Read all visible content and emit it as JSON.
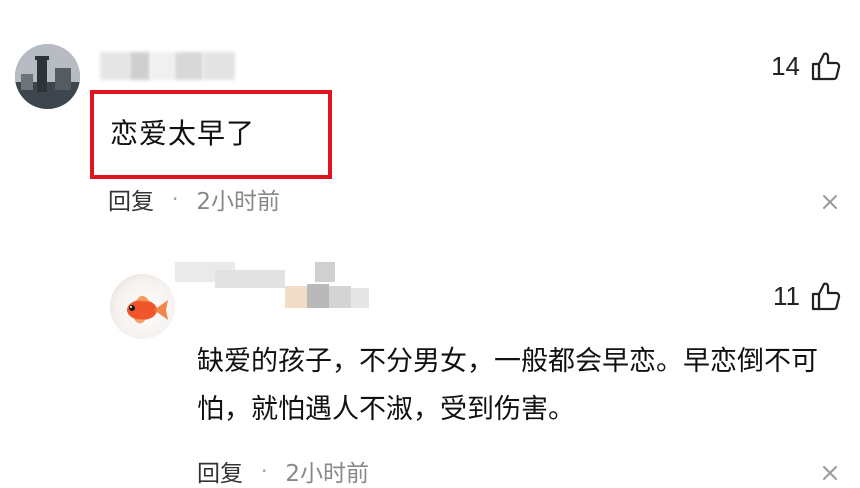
{
  "comments": [
    {
      "text": "恋爱太早了",
      "likes": "14",
      "reply_label": "回复",
      "separator": "·",
      "time": "2小时前"
    },
    {
      "text": "缺爱的孩子，不分男女，一般都会早恋。早恋倒不可怕，就怕遇人不淑，受到伤害。",
      "likes": "11",
      "reply_label": "回复",
      "separator": "·",
      "time": "2小时前"
    }
  ],
  "icons": {
    "like": "thumbs-up-icon",
    "close": "close-icon"
  },
  "colors": {
    "highlight": "#e0141e",
    "meta_text": "#888888"
  }
}
